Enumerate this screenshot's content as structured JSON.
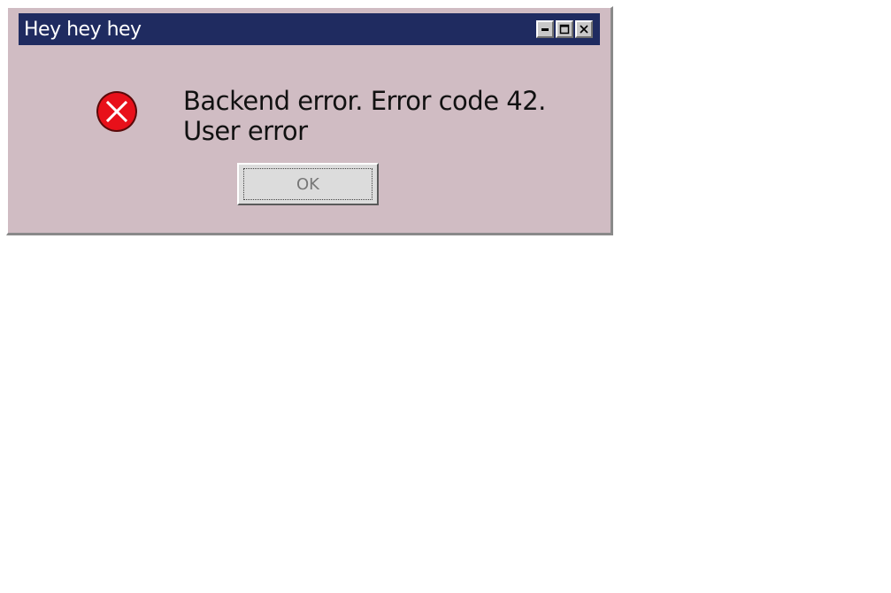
{
  "window": {
    "title": "Hey hey hey",
    "buttons": {
      "minimize_icon": "minimize-icon",
      "maximize_icon": "maximize-icon",
      "close_icon": "close-icon"
    }
  },
  "dialog": {
    "icon": "error-icon",
    "message": "Backend error. Error code 42. User error",
    "ok_label": "OK"
  },
  "colors": {
    "titlebar": "#1f2b60",
    "dialog_bg": "#d0bcc3",
    "error_red": "#e8101a"
  }
}
